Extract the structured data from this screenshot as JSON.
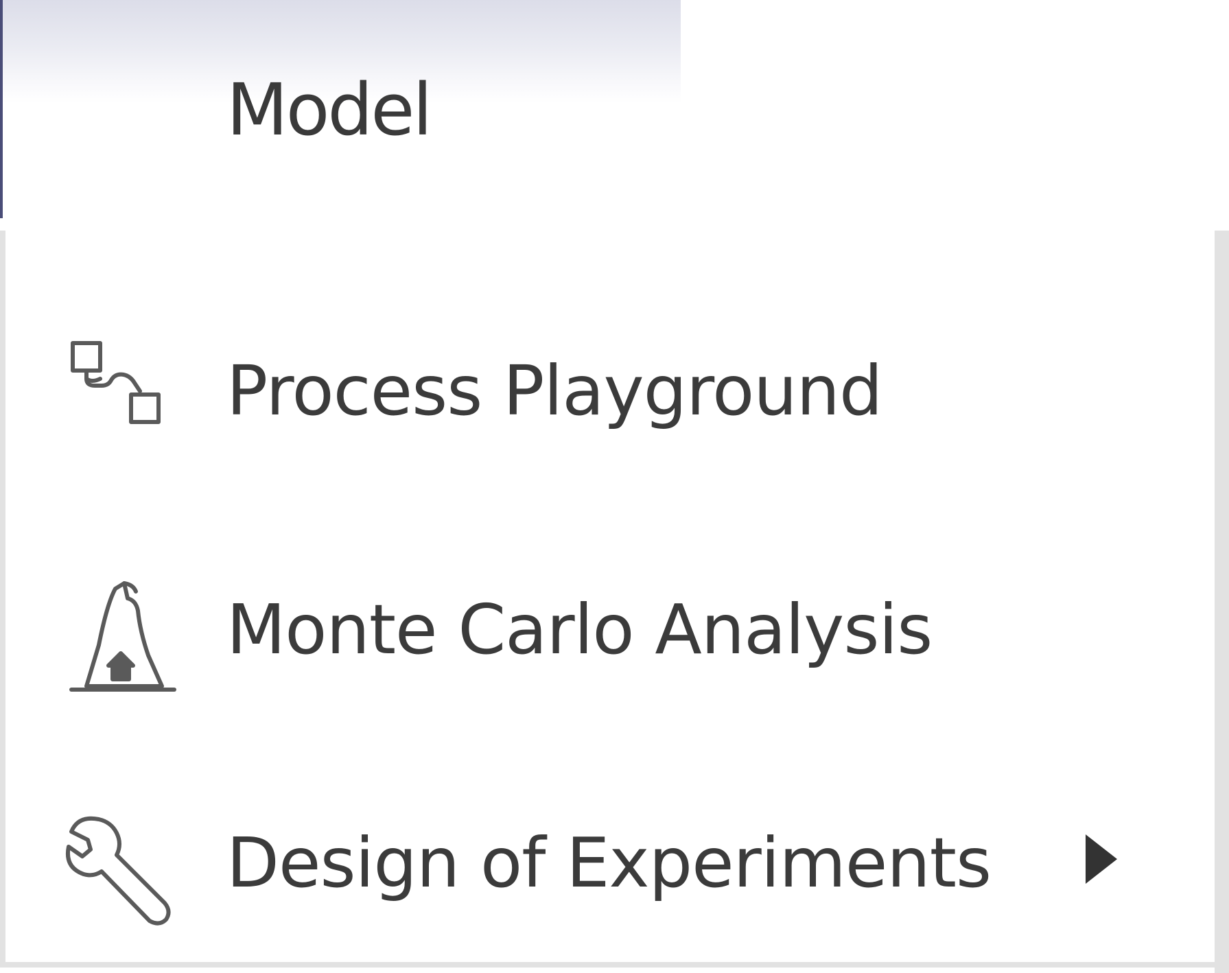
{
  "tab": {
    "title": "Model"
  },
  "menu": {
    "items": [
      {
        "label": "Process Playground",
        "icon": "process-flow-icon",
        "has_submenu": false
      },
      {
        "label": "Monte Carlo Analysis",
        "icon": "wizard-hat-icon",
        "has_submenu": false
      },
      {
        "label": "Design of Experiments",
        "icon": "wrench-icon",
        "has_submenu": true
      }
    ]
  },
  "colors": {
    "tab_edge": "#4a4d78",
    "text": "#3b3b3b",
    "panel_border": "#e2e2e2"
  }
}
